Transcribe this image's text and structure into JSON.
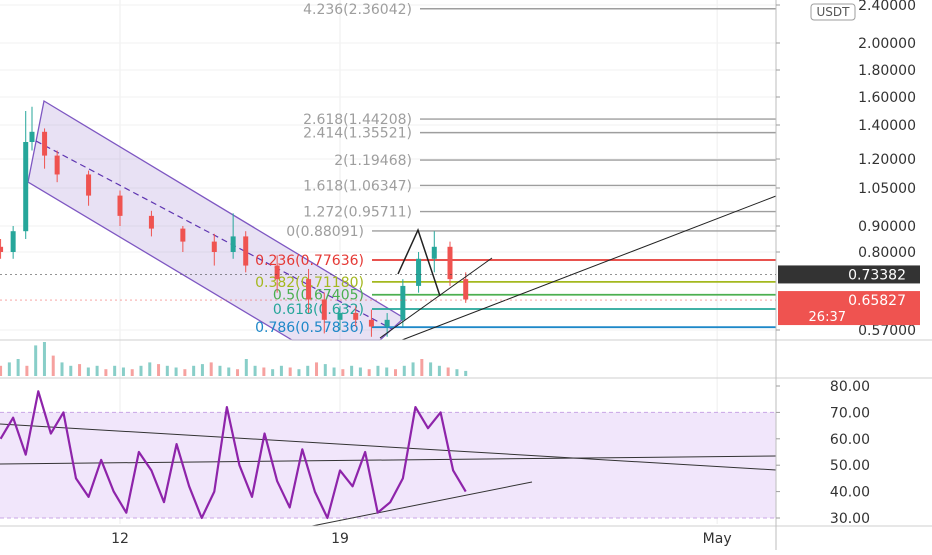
{
  "chart_data": [
    {
      "type": "candlestick",
      "panel": "price",
      "quote_currency": "USDT",
      "y_ticks": [
        {
          "value": 2.4,
          "label": "2.40000"
        },
        {
          "value": 2.0,
          "label": "2.00000"
        },
        {
          "value": 1.8,
          "label": "1.80000"
        },
        {
          "value": 1.6,
          "label": "1.60000"
        },
        {
          "value": 1.4,
          "label": "1.40000"
        },
        {
          "value": 1.2,
          "label": "1.20000"
        },
        {
          "value": 1.05,
          "label": "1.05000"
        },
        {
          "value": 0.9,
          "label": "0.90000"
        },
        {
          "value": 0.8,
          "label": "0.80000"
        },
        {
          "value": 0.57,
          "label": "0.57000"
        }
      ],
      "price_badges": [
        {
          "value": 0.73382,
          "label": "0.73382",
          "color": "#333333"
        },
        {
          "value": 0.65827,
          "label": "0.65827",
          "sublabel": "26:37",
          "color": "#ef5350"
        }
      ],
      "fibonacci_levels": [
        {
          "label": "4.236(2.36042)",
          "value": 2.36042,
          "color": "#9e9e9e"
        },
        {
          "label": "2.618(1.44208)",
          "value": 1.44208,
          "color": "#9e9e9e"
        },
        {
          "label": "2.414(1.35521)",
          "value": 1.35521,
          "color": "#9e9e9e"
        },
        {
          "label": "2(1.19468)",
          "value": 1.19468,
          "color": "#9e9e9e"
        },
        {
          "label": "1.618(1.06347)",
          "value": 1.06347,
          "color": "#9e9e9e"
        },
        {
          "label": "1.272(0.95711)",
          "value": 0.95711,
          "color": "#9e9e9e"
        },
        {
          "label": "0(0.88091)",
          "value": 0.88091,
          "color": "#9e9e9e"
        },
        {
          "label": "0.236(0.77636)",
          "value": 0.77636,
          "color": "#e53935"
        },
        {
          "label": "0.382(0.71180)",
          "value": 0.7118,
          "color": "#a4b81e"
        },
        {
          "label": "0.5(0.67405)",
          "value": 0.67405,
          "color": "#4caf50"
        },
        {
          "label": "0.618(0.632)",
          "value": 0.632,
          "color": "#26a69a"
        },
        {
          "label": "0.786(0.57836)",
          "value": 0.57836,
          "color": "#1e88c8"
        }
      ],
      "x_ticks": [
        {
          "day": 12,
          "label": "12"
        },
        {
          "day": 19,
          "label": "19"
        },
        {
          "day": 31,
          "label": "May"
        }
      ],
      "x_range": [
        8.2,
        34
      ],
      "candles_approx": [
        {
          "day": 8.2,
          "open": 0.82,
          "high": 0.85,
          "low": 0.78,
          "close": 0.8
        },
        {
          "day": 8.6,
          "open": 0.8,
          "high": 0.9,
          "low": 0.78,
          "close": 0.88
        },
        {
          "day": 9.0,
          "open": 0.88,
          "high": 1.5,
          "low": 0.85,
          "close": 1.3
        },
        {
          "day": 9.2,
          "open": 1.3,
          "high": 1.53,
          "low": 1.25,
          "close": 1.36
        },
        {
          "day": 9.6,
          "open": 1.36,
          "high": 1.38,
          "low": 1.15,
          "close": 1.22
        },
        {
          "day": 10.0,
          "open": 1.22,
          "high": 1.25,
          "low": 1.08,
          "close": 1.12
        },
        {
          "day": 11.0,
          "open": 1.12,
          "high": 1.14,
          "low": 0.98,
          "close": 1.02
        },
        {
          "day": 12.0,
          "open": 1.02,
          "high": 1.04,
          "low": 0.9,
          "close": 0.94
        },
        {
          "day": 13.0,
          "open": 0.94,
          "high": 0.96,
          "low": 0.86,
          "close": 0.89
        },
        {
          "day": 14.0,
          "open": 0.89,
          "high": 0.9,
          "low": 0.8,
          "close": 0.84
        },
        {
          "day": 15.0,
          "open": 0.84,
          "high": 0.87,
          "low": 0.76,
          "close": 0.8
        },
        {
          "day": 15.6,
          "open": 0.8,
          "high": 0.95,
          "low": 0.78,
          "close": 0.86
        },
        {
          "day": 16.0,
          "open": 0.86,
          "high": 0.88,
          "low": 0.74,
          "close": 0.76
        },
        {
          "day": 17.0,
          "open": 0.76,
          "high": 0.79,
          "low": 0.68,
          "close": 0.72
        },
        {
          "day": 18.0,
          "open": 0.72,
          "high": 0.75,
          "low": 0.62,
          "close": 0.66
        },
        {
          "day": 18.5,
          "open": 0.66,
          "high": 0.68,
          "low": 0.56,
          "close": 0.6
        },
        {
          "day": 19.0,
          "open": 0.6,
          "high": 0.64,
          "low": 0.57,
          "close": 0.62
        },
        {
          "day": 19.5,
          "open": 0.62,
          "high": 0.64,
          "low": 0.58,
          "close": 0.6
        },
        {
          "day": 20.0,
          "open": 0.6,
          "high": 0.63,
          "low": 0.55,
          "close": 0.58
        },
        {
          "day": 20.5,
          "open": 0.58,
          "high": 0.62,
          "low": 0.55,
          "close": 0.6
        },
        {
          "day": 21.0,
          "open": 0.6,
          "high": 0.72,
          "low": 0.58,
          "close": 0.7
        },
        {
          "day": 21.5,
          "open": 0.7,
          "high": 0.8,
          "low": 0.68,
          "close": 0.78
        },
        {
          "day": 22.0,
          "open": 0.78,
          "high": 0.88,
          "low": 0.74,
          "close": 0.82
        },
        {
          "day": 22.5,
          "open": 0.82,
          "high": 0.84,
          "low": 0.7,
          "close": 0.72
        },
        {
          "day": 23.0,
          "open": 0.72,
          "high": 0.74,
          "low": 0.65,
          "close": 0.66
        }
      ]
    },
    {
      "type": "bar",
      "panel": "volume",
      "note_values_relative": true,
      "values": [
        0.3,
        0.4,
        0.5,
        0.3,
        0.9,
        1.0,
        0.6,
        0.4,
        0.3,
        0.35,
        0.25,
        0.3,
        0.2,
        0.3,
        0.25,
        0.2,
        0.3,
        0.4,
        0.35,
        0.3,
        0.25,
        0.2,
        0.3,
        0.35,
        0.4,
        0.3,
        0.25,
        0.2,
        0.5,
        0.3,
        0.25,
        0.2,
        0.3,
        0.25,
        0.2,
        0.3,
        0.4,
        0.35,
        0.25,
        0.2,
        0.3,
        0.25,
        0.2,
        0.3,
        0.25,
        0.2,
        0.3,
        0.4,
        0.5,
        0.4,
        0.3,
        0.25,
        0.2,
        0.15
      ]
    },
    {
      "type": "line",
      "panel": "oscillator",
      "y_ticks": [
        {
          "value": 80,
          "label": "80.00"
        },
        {
          "value": 70,
          "label": "70.00"
        },
        {
          "value": 60,
          "label": "60.00"
        },
        {
          "value": 50,
          "label": "50.00"
        },
        {
          "value": 40,
          "label": "40.00"
        },
        {
          "value": 30,
          "label": "30.00"
        }
      ],
      "band": [
        30,
        70
      ],
      "series": [
        {
          "color": "#8e24aa",
          "x": [
            8.2,
            8.6,
            9.0,
            9.4,
            9.8,
            10.2,
            10.6,
            11.0,
            11.4,
            11.8,
            12.2,
            12.6,
            13.0,
            13.4,
            13.8,
            14.2,
            14.6,
            15.0,
            15.4,
            15.8,
            16.2,
            16.6,
            17.0,
            17.4,
            17.8,
            18.2,
            18.6,
            19.0,
            19.4,
            19.8,
            20.2,
            20.6,
            21.0,
            21.4,
            21.8,
            22.2,
            22.6,
            23.0
          ],
          "y": [
            60,
            68,
            54,
            78,
            62,
            70,
            45,
            38,
            52,
            40,
            32,
            55,
            48,
            36,
            58,
            42,
            30,
            40,
            72,
            50,
            38,
            62,
            44,
            34,
            56,
            40,
            30,
            48,
            42,
            55,
            32,
            36,
            45,
            72,
            64,
            70,
            48,
            40
          ]
        }
      ]
    }
  ]
}
